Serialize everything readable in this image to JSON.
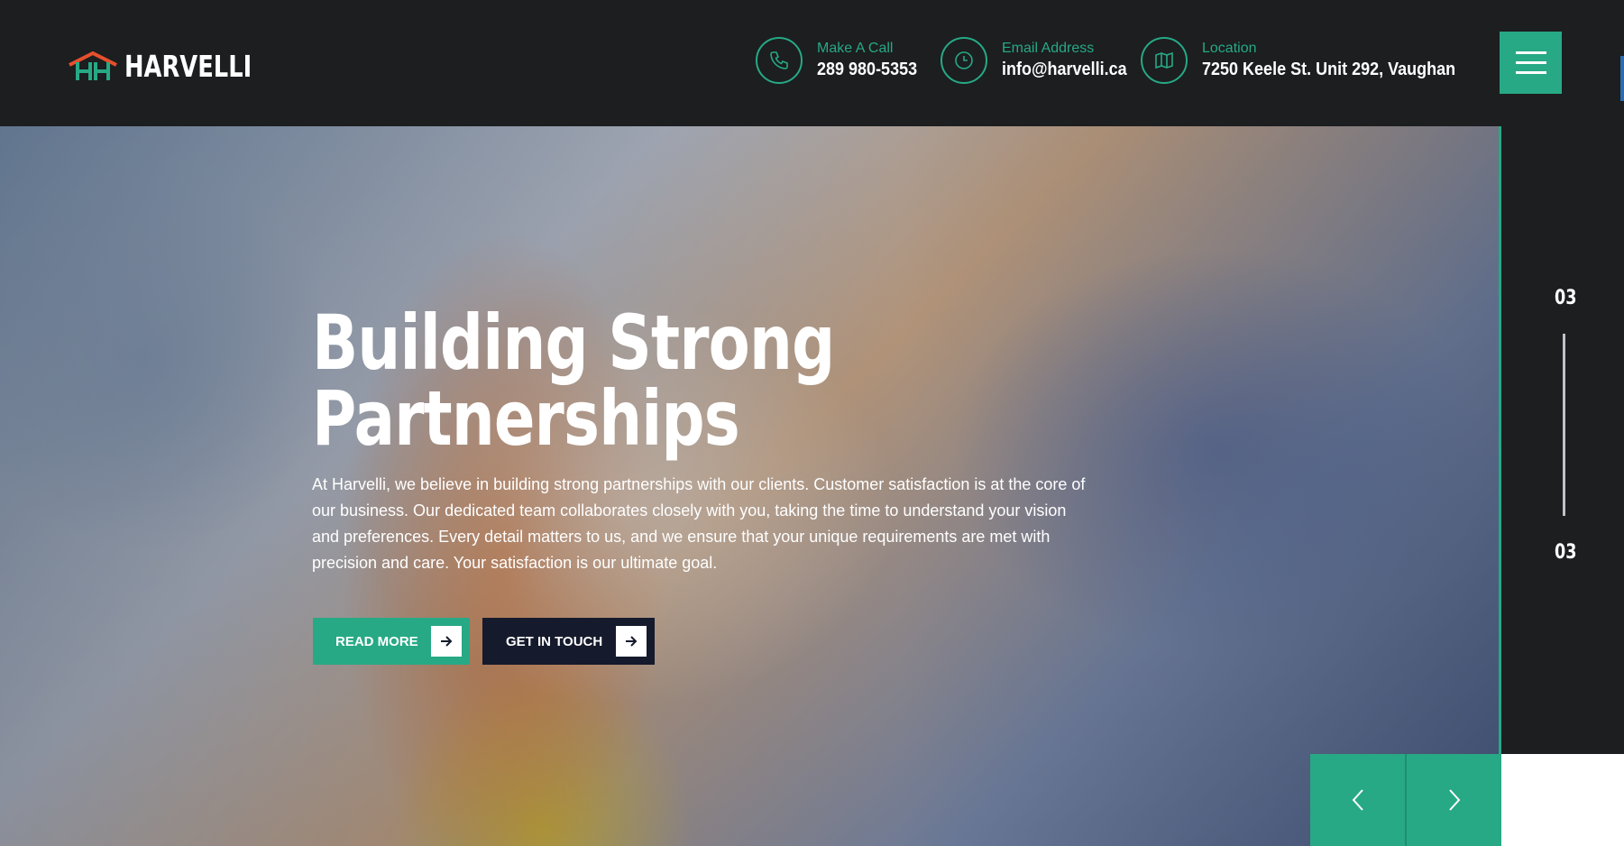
{
  "header": {
    "logo_text": "HARVELLI",
    "contacts": [
      {
        "label": "Make A Call",
        "value": "289 980-5353",
        "icon": "phone-icon"
      },
      {
        "label": "Email Address",
        "value": "info@harvelli.ca",
        "icon": "clock-icon"
      },
      {
        "label": "Location",
        "value": "7250 Keele St. Unit 292, Vaughan",
        "icon": "map-icon"
      }
    ],
    "menu_icon": "hamburger-menu-icon"
  },
  "hero": {
    "title_line1": "Building Strong",
    "title_line2": "Partnerships",
    "description": "At Harvelli, we believe in building strong partnerships with our clients. Customer satisfaction is at the core of our business. Our dedicated team collaborates closely with you, taking the time to understand your vision and preferences. Every detail matters to us, and we ensure that your unique requirements are met with precision and care. Your satisfaction is our ultimate goal.",
    "buttons": {
      "read_more": "READ MORE",
      "get_in_touch": "GET IN TOUCH"
    }
  },
  "slider": {
    "current": "03",
    "total": "03",
    "prev_icon": "chevron-left-icon",
    "next_icon": "chevron-right-icon"
  },
  "colors": {
    "accent": "#27a985",
    "header_bg": "#1c1e20",
    "dark_button": "#151a2c"
  }
}
